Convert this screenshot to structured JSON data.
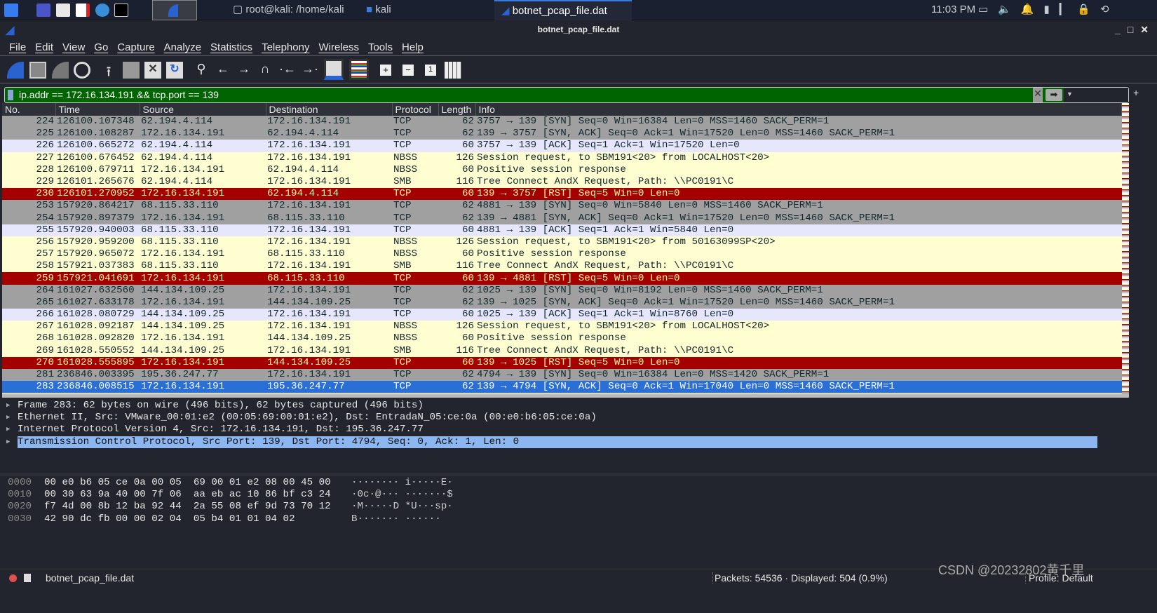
{
  "taskbar": {
    "tasks": [
      {
        "label": "root@kali: /home/kali"
      },
      {
        "label": "kali"
      },
      {
        "label": "botnet_pcap_file.dat"
      }
    ],
    "clock": "11:03 PM"
  },
  "window": {
    "title": "botnet_pcap_file.dat"
  },
  "menu": [
    "File",
    "Edit",
    "View",
    "Go",
    "Capture",
    "Analyze",
    "Statistics",
    "Telephony",
    "Wireless",
    "Tools",
    "Help"
  ],
  "filter": {
    "value": "ip.addr == 172.16.134.191 && tcp.port == 139",
    "bg_color": "#006400"
  },
  "columns": [
    "No.",
    "Time",
    "Source",
    "Destination",
    "Protocol",
    "Length",
    "Info"
  ],
  "colors": {
    "syn": "#a0a0a0",
    "ack": "#e7e6ff",
    "smb": "#fefed0",
    "rst": "#a40000",
    "rst_text": "#fffc9c",
    "selected": "#2a6fd6"
  },
  "packets": [
    [
      "224",
      "126100.107348",
      "62.194.4.114",
      "172.16.134.191",
      "TCP",
      "62",
      "3757 → 139 [SYN] Seq=0 Win=16384 Len=0 MSS=1460 SACK_PERM=1",
      "syn"
    ],
    [
      "225",
      "126100.108287",
      "172.16.134.191",
      "62.194.4.114",
      "TCP",
      "62",
      "139 → 3757 [SYN, ACK] Seq=0 Ack=1 Win=17520 Len=0 MSS=1460 SACK_PERM=1",
      "syn"
    ],
    [
      "226",
      "126100.665272",
      "62.194.4.114",
      "172.16.134.191",
      "TCP",
      "60",
      "3757 → 139 [ACK] Seq=1 Ack=1 Win=17520 Len=0",
      "ack"
    ],
    [
      "227",
      "126100.676452",
      "62.194.4.114",
      "172.16.134.191",
      "NBSS",
      "126",
      "Session request, to SBM191<20> from LOCALHOST<20>",
      "smb"
    ],
    [
      "228",
      "126100.679711",
      "172.16.134.191",
      "62.194.4.114",
      "NBSS",
      "60",
      "Positive session response",
      "smb"
    ],
    [
      "229",
      "126101.265676",
      "62.194.4.114",
      "172.16.134.191",
      "SMB",
      "116",
      "Tree Connect AndX Request, Path: \\\\PC0191\\C",
      "smb"
    ],
    [
      "230",
      "126101.270952",
      "172.16.134.191",
      "62.194.4.114",
      "TCP",
      "60",
      "139 → 3757 [RST] Seq=5 Win=0 Len=0",
      "rst"
    ],
    [
      "253",
      "157920.864217",
      "68.115.33.110",
      "172.16.134.191",
      "TCP",
      "62",
      "4881 → 139 [SYN] Seq=0 Win=5840 Len=0 MSS=1460 SACK_PERM=1",
      "syn"
    ],
    [
      "254",
      "157920.897379",
      "172.16.134.191",
      "68.115.33.110",
      "TCP",
      "62",
      "139 → 4881 [SYN, ACK] Seq=0 Ack=1 Win=17520 Len=0 MSS=1460 SACK_PERM=1",
      "syn"
    ],
    [
      "255",
      "157920.940003",
      "68.115.33.110",
      "172.16.134.191",
      "TCP",
      "60",
      "4881 → 139 [ACK] Seq=1 Ack=1 Win=5840 Len=0",
      "ack"
    ],
    [
      "256",
      "157920.959200",
      "68.115.33.110",
      "172.16.134.191",
      "NBSS",
      "126",
      "Session request, to SBM191<20> from 50163099SP<20>",
      "smb"
    ],
    [
      "257",
      "157920.965072",
      "172.16.134.191",
      "68.115.33.110",
      "NBSS",
      "60",
      "Positive session response",
      "smb"
    ],
    [
      "258",
      "157921.037383",
      "68.115.33.110",
      "172.16.134.191",
      "SMB",
      "116",
      "Tree Connect AndX Request, Path: \\\\PC0191\\C",
      "smb"
    ],
    [
      "259",
      "157921.041691",
      "172.16.134.191",
      "68.115.33.110",
      "TCP",
      "60",
      "139 → 4881 [RST] Seq=5 Win=0 Len=0",
      "rst"
    ],
    [
      "264",
      "161027.632560",
      "144.134.109.25",
      "172.16.134.191",
      "TCP",
      "62",
      "1025 → 139 [SYN] Seq=0 Win=8192 Len=0 MSS=1460 SACK_PERM=1",
      "syn"
    ],
    [
      "265",
      "161027.633178",
      "172.16.134.191",
      "144.134.109.25",
      "TCP",
      "62",
      "139 → 1025 [SYN, ACK] Seq=0 Ack=1 Win=17520 Len=0 MSS=1460 SACK_PERM=1",
      "syn"
    ],
    [
      "266",
      "161028.080729",
      "144.134.109.25",
      "172.16.134.191",
      "TCP",
      "60",
      "1025 → 139 [ACK] Seq=1 Ack=1 Win=8760 Len=0",
      "ack"
    ],
    [
      "267",
      "161028.092187",
      "144.134.109.25",
      "172.16.134.191",
      "NBSS",
      "126",
      "Session request, to SBM191<20> from LOCALHOST<20>",
      "smb"
    ],
    [
      "268",
      "161028.092820",
      "172.16.134.191",
      "144.134.109.25",
      "NBSS",
      "60",
      "Positive session response",
      "smb"
    ],
    [
      "269",
      "161028.550552",
      "144.134.109.25",
      "172.16.134.191",
      "SMB",
      "116",
      "Tree Connect AndX Request, Path: \\\\PC0191\\C",
      "smb"
    ],
    [
      "270",
      "161028.555895",
      "172.16.134.191",
      "144.134.109.25",
      "TCP",
      "60",
      "139 → 1025 [RST] Seq=5 Win=0 Len=0",
      "rst"
    ],
    [
      "281",
      "236846.003395",
      "195.36.247.77",
      "172.16.134.191",
      "TCP",
      "62",
      "4794 → 139 [SYN] Seq=0 Win=16384 Len=0 MSS=1420 SACK_PERM=1",
      "syn"
    ],
    [
      "283",
      "236846.008515",
      "172.16.134.191",
      "195.36.247.77",
      "TCP",
      "62",
      "139 → 4794 [SYN, ACK] Seq=0 Ack=1 Win=17040 Len=0 MSS=1460 SACK_PERM=1",
      "selected"
    ]
  ],
  "details": [
    "Frame 283: 62 bytes on wire (496 bits), 62 bytes captured (496 bits)",
    "Ethernet II, Src: VMware_00:01:e2 (00:05:69:00:01:e2), Dst: EntradaN_05:ce:0a (00:e0:b6:05:ce:0a)",
    "Internet Protocol Version 4, Src: 172.16.134.191, Dst: 195.36.247.77",
    "Transmission Control Protocol, Src Port: 139, Dst Port: 4794, Seq: 0, Ack: 1, Len: 0"
  ],
  "hex": [
    {
      "offset": "0000",
      "bytes": "00 e0 b6 05 ce 0a 00 05  69 00 01 e2 08 00 45 00",
      "ascii": "········ i·····E·"
    },
    {
      "offset": "0010",
      "bytes": "00 30 63 9a 40 00 7f 06  aa eb ac 10 86 bf c3 24",
      "ascii": "·0c·@··· ·······$"
    },
    {
      "offset": "0020",
      "bytes": "f7 4d 00 8b 12 ba 92 44  2a 55 08 ef 9d 73 70 12",
      "ascii": "·M·····D *U···sp·"
    },
    {
      "offset": "0030",
      "bytes": "42 90 dc fb 00 00 02 04  05 b4 01 01 04 02",
      "ascii": "B······· ······"
    }
  ],
  "status": {
    "file": "botnet_pcap_file.dat",
    "packets": "Packets: 54536 · Displayed: 504 (0.9%)",
    "profile": "Profile: Default",
    "watermark": "CSDN @20232802黄千里"
  }
}
